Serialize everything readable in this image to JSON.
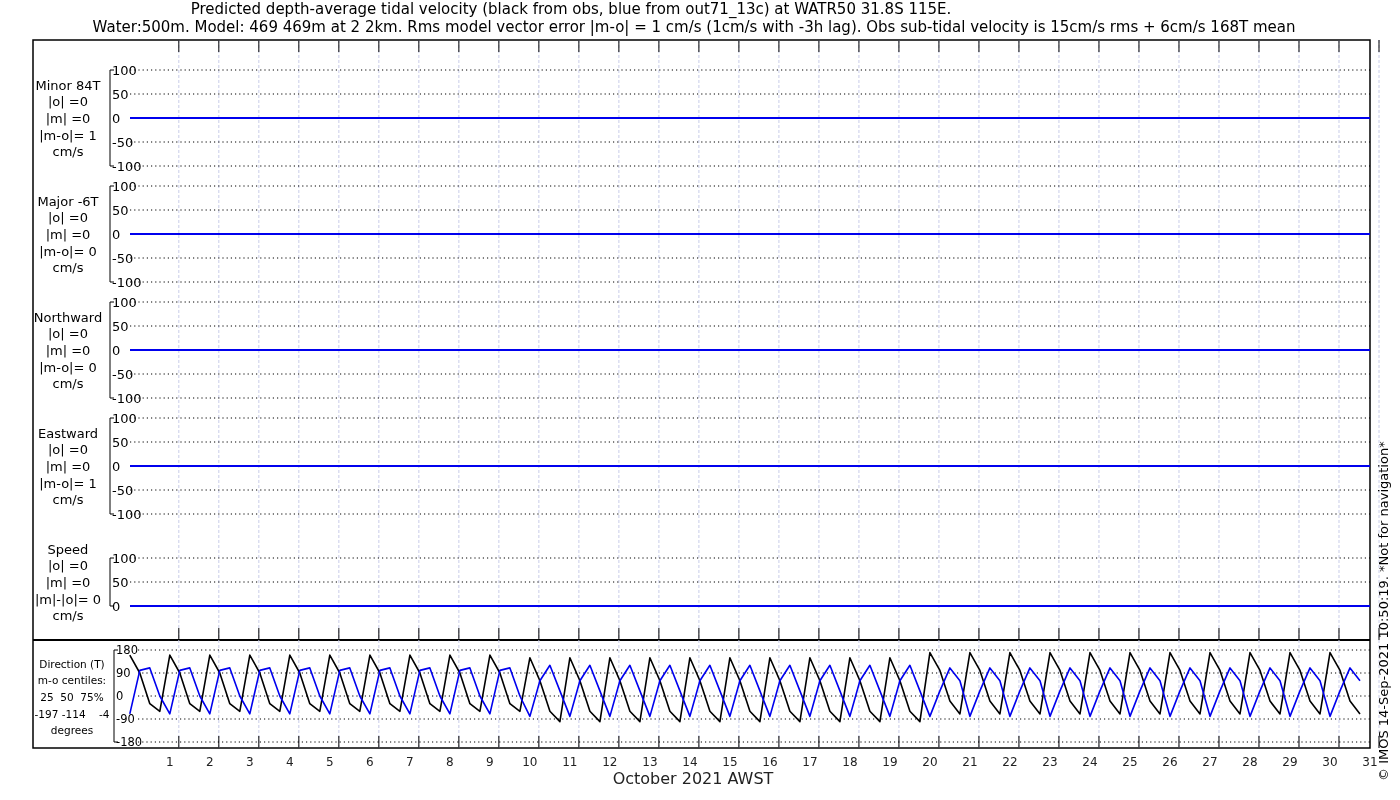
{
  "title": {
    "lines": [
      "Predicted depth-average tidal velocity (black from obs, blue from out71_13c) at WATR50 31.8S 115E.",
      "Water:500m. Model: 469 469m at 2 2km. Rms model vector error |m-o| = 1 cm/s (1cm/s with -3h lag). Obs sub-tidal velocity is 15cm/s rms + 6cm/s 168T mean"
    ]
  },
  "panels": [
    {
      "kind": "signed",
      "label_lines": [
        "Minor 84T",
        "|o| =0",
        "|m| =0",
        "|m-o|= 1",
        "cm/s"
      ],
      "yticks": [
        "100",
        "50",
        "0",
        "-50",
        "-100"
      ]
    },
    {
      "kind": "signed",
      "label_lines": [
        "Major -6T",
        "|o| =0",
        "|m| =0",
        "|m-o|= 0",
        "cm/s"
      ],
      "yticks": [
        "100",
        "50",
        "0",
        "-50",
        "-100"
      ]
    },
    {
      "kind": "signed",
      "label_lines": [
        "Northward",
        "|o| =0",
        "|m| =0",
        "|m-o|= 0",
        "cm/s"
      ],
      "yticks": [
        "100",
        "50",
        "0",
        "-50",
        "-100"
      ]
    },
    {
      "kind": "signed",
      "label_lines": [
        "Eastward",
        "|o| =0",
        "|m| =0",
        "|m-o|= 1",
        "cm/s"
      ],
      "yticks": [
        "100",
        "50",
        "0",
        "-50",
        "-100"
      ]
    },
    {
      "kind": "speed",
      "label_lines": [
        "Speed",
        "|o| =0",
        "|m| =0",
        "|m|-|o|= 0",
        "cm/s"
      ],
      "yticks": [
        "100",
        "50",
        "0"
      ]
    }
  ],
  "direction_panel": {
    "label_lines": [
      "Direction (T)",
      "m-o centiles:",
      "25  50  75%",
      "-197 -114    -4",
      "degrees"
    ],
    "chart_data": {
      "type": "line",
      "grid": true,
      "xlim": [
        -2.42,
        31
      ],
      "ylim": [
        -180,
        180
      ],
      "yticks": [
        180,
        90,
        0,
        -90,
        -180
      ],
      "xticks": [
        1,
        2,
        3,
        4,
        5,
        6,
        7,
        8,
        9,
        10,
        11,
        12,
        13,
        14,
        15,
        16,
        17,
        18,
        19,
        20,
        21,
        22,
        23,
        24,
        25,
        26,
        27,
        28,
        29,
        30,
        31
      ],
      "x": [
        0,
        0.25,
        0.5,
        0.75,
        1,
        1.25,
        1.5,
        1.75,
        2,
        2.25,
        2.5,
        2.75,
        3,
        3.25,
        3.5,
        3.75,
        4,
        4.25,
        4.5,
        4.75,
        5,
        5.25,
        5.5,
        5.75,
        6,
        6.25,
        6.5,
        6.75,
        7,
        7.25,
        7.5,
        7.75,
        8,
        8.25,
        8.5,
        8.75,
        9,
        9.25,
        9.5,
        9.75,
        10,
        10.25,
        10.5,
        10.75,
        11,
        11.25,
        11.5,
        11.75,
        12,
        12.25,
        12.5,
        12.75,
        13,
        13.25,
        13.5,
        13.75,
        14,
        14.25,
        14.5,
        14.75,
        15,
        15.25,
        15.5,
        15.75,
        16,
        16.25,
        16.5,
        16.75,
        17,
        17.25,
        17.5,
        17.75,
        18,
        18.25,
        18.5,
        18.75,
        19,
        19.25,
        19.5,
        19.75,
        20,
        20.25,
        20.5,
        20.75,
        21,
        21.25,
        21.5,
        21.75,
        22,
        22.25,
        22.5,
        22.75,
        23,
        23.25,
        23.5,
        23.75,
        24,
        24.25,
        24.5,
        24.75,
        25,
        25.25,
        25.5,
        25.75,
        26,
        26.25,
        26.5,
        26.75,
        27,
        27.25,
        27.5,
        27.75,
        28,
        28.25,
        28.5,
        28.75,
        29,
        29.25,
        29.5,
        29.75,
        30,
        30.25,
        30.5,
        30.75
      ],
      "series": [
        {
          "color": "#000000",
          "values": [
            160,
            90,
            -30,
            -60,
            160,
            90,
            -30,
            -60,
            160,
            90,
            -30,
            -60,
            160,
            90,
            -30,
            -60,
            160,
            90,
            -30,
            -60,
            160,
            90,
            -30,
            -60,
            160,
            90,
            -30,
            -60,
            160,
            90,
            -30,
            -60,
            160,
            90,
            -30,
            -60,
            160,
            90,
            -30,
            -60,
            150,
            60,
            -60,
            -100,
            150,
            60,
            -60,
            -100,
            150,
            60,
            -60,
            -100,
            150,
            60,
            -60,
            -100,
            150,
            60,
            -60,
            -100,
            150,
            60,
            -60,
            -100,
            150,
            60,
            -60,
            -100,
            150,
            60,
            -60,
            -100,
            150,
            60,
            -60,
            -100,
            150,
            60,
            -60,
            -100,
            170,
            100,
            -20,
            -70,
            170,
            100,
            -20,
            -70,
            170,
            100,
            -20,
            -70,
            170,
            100,
            -20,
            -70,
            170,
            100,
            -20,
            -70,
            170,
            100,
            -20,
            -70,
            170,
            100,
            -20,
            -70,
            170,
            100,
            -20,
            -70,
            170,
            100,
            -20,
            -70,
            170,
            100,
            -20,
            -70,
            170,
            100,
            -20,
            -70
          ]
        },
        {
          "color": "#0000ee",
          "values": [
            -70,
            100,
            110,
            0,
            -70,
            100,
            110,
            0,
            -70,
            100,
            110,
            0,
            -70,
            100,
            110,
            0,
            -70,
            100,
            110,
            0,
            -70,
            100,
            110,
            0,
            -70,
            100,
            110,
            0,
            -70,
            100,
            110,
            0,
            -70,
            100,
            110,
            0,
            -70,
            100,
            110,
            0,
            -80,
            60,
            120,
            20,
            -80,
            60,
            120,
            20,
            -80,
            60,
            120,
            20,
            -80,
            60,
            120,
            20,
            -80,
            60,
            120,
            20,
            -80,
            60,
            120,
            20,
            -80,
            60,
            120,
            20,
            -80,
            60,
            120,
            20,
            -80,
            60,
            120,
            20,
            -80,
            60,
            120,
            20,
            -80,
            20,
            110,
            60,
            -80,
            20,
            110,
            60,
            -80,
            20,
            110,
            60,
            -80,
            20,
            110,
            60,
            -80,
            20,
            110,
            60,
            -80,
            20,
            110,
            60,
            -80,
            20,
            110,
            60,
            -80,
            20,
            110,
            60,
            -80,
            20,
            110,
            60,
            -80,
            20,
            110,
            60,
            -80,
            20,
            110,
            60
          ]
        }
      ]
    }
  },
  "x_axis": {
    "label": "October 2021 AWST"
  },
  "credit": "© IMOS 14-Sep-2021 10:50:19. *Not for navigation*"
}
